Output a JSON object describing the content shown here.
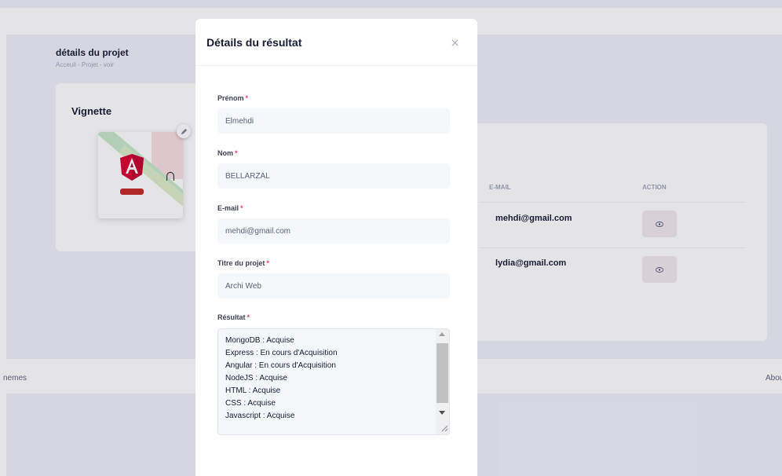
{
  "page": {
    "title": "détails du projet",
    "breadcrumb": "Acceuil  -  Projet  -  voir",
    "thumbnail_card_title": "Vignette",
    "table": {
      "headers": {
        "email": "E-MAIL",
        "action": "ACTION"
      },
      "rows": [
        {
          "email": "mehdi@gmail.com"
        },
        {
          "email": "lydia@gmail.com"
        }
      ]
    },
    "footer": {
      "left": "nemes",
      "right": "Abou"
    }
  },
  "modal": {
    "title": "Détails du résultat",
    "required_mark": "*",
    "fields": {
      "prenom": {
        "label": "Prénom",
        "value": "Elmehdi"
      },
      "nom": {
        "label": "Nom",
        "value": "BELLARZAL"
      },
      "email": {
        "label": "E-mail",
        "value": "mehdi@gmail.com"
      },
      "titre": {
        "label": "Titre du projet",
        "value": "Archi Web"
      },
      "resultat": {
        "label": "Résultat",
        "lines": [
          "MongoDB : Acquise",
          "Express : En cours d'Acquisition",
          "Angular : En cours d'Acquisition",
          "NodeJS : Acquise",
          "HTML : Acquise",
          "CSS : Acquise",
          "Javascript : Acquise"
        ]
      }
    }
  },
  "colors": {
    "required": "#f1416c",
    "input_bg": "#f5f8fa",
    "angular_red": "#dd0031"
  },
  "icons": [
    "close-icon",
    "eye-icon",
    "pencil-icon",
    "angular-logo",
    "node-logo"
  ]
}
